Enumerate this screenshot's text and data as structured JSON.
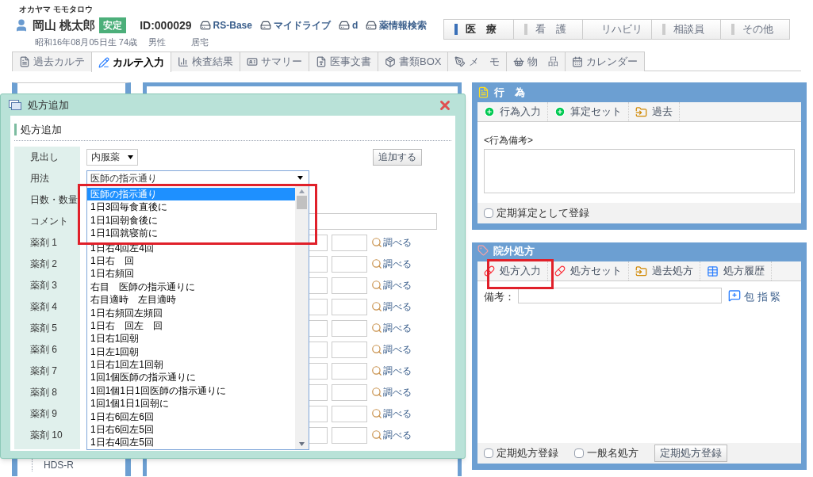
{
  "patient": {
    "kana": "オカヤマ モモタロウ",
    "name": "岡山 桃太郎",
    "status": "安定",
    "id": "ID:000029",
    "links": [
      "RS-Base",
      "マイドライブ",
      "d",
      "薬情報検索"
    ],
    "birth": "昭和16年08月05日生 74歳",
    "sex": "男性",
    "residence": "居宅"
  },
  "dept_tabs": [
    {
      "label": "医　療",
      "selected": true
    },
    {
      "label": "看　護",
      "selected": false
    },
    {
      "label": "リハビリ",
      "selected": false
    },
    {
      "label": "相談員",
      "selected": false
    },
    {
      "label": "その他",
      "selected": false
    }
  ],
  "main_tabs": [
    {
      "label": "過去カルテ",
      "selected": false
    },
    {
      "label": "カルテ入力",
      "selected": true
    },
    {
      "label": "検査結果",
      "selected": false
    },
    {
      "label": "サマリー",
      "selected": false
    },
    {
      "label": "医事文書",
      "selected": false
    },
    {
      "label": "書類BOX",
      "selected": false
    },
    {
      "label": "メ　モ",
      "selected": false
    },
    {
      "label": "物　品",
      "selected": false
    },
    {
      "label": "カレンダー",
      "selected": false
    }
  ],
  "sidebar": {
    "items": [
      "HDS-R"
    ]
  },
  "act_panel": {
    "title": "行　為",
    "toolbar": [
      "行為入力",
      "算定セット",
      "過去"
    ],
    "note_label": "<行為備考>",
    "footer_checkbox": {
      "label": "定期算定として登録",
      "checked": false
    }
  },
  "rx_panel": {
    "title": "院外処方",
    "toolbar": [
      "処方入力",
      "処方セット",
      "過去処方",
      "処方履歴"
    ],
    "note_label": "備考：",
    "note_tags": "包 指 緊",
    "footer_checkboxes": [
      {
        "label": "定期処方登録",
        "checked": false
      },
      {
        "label": "一般名処方",
        "checked": false
      }
    ],
    "footer_button": "定期処方登録"
  },
  "modal": {
    "title": "処方追加",
    "section_title": "処方追加",
    "heading": {
      "label": "見出し",
      "value": "内服薬"
    },
    "add_button": "追加する",
    "usage": {
      "label": "用法",
      "value": "医師の指示通り"
    },
    "days_label": "日数・数量",
    "comment_label": "コメント",
    "drugs": [
      {
        "label": "薬剤 1",
        "link": "調べる"
      },
      {
        "label": "薬剤 2",
        "link": "調べる"
      },
      {
        "label": "薬剤 3",
        "link": "調べる"
      },
      {
        "label": "薬剤 4",
        "link": "調べる"
      },
      {
        "label": "薬剤 5",
        "link": "調べる"
      },
      {
        "label": "薬剤 6",
        "link": "調べる"
      },
      {
        "label": "薬剤 7",
        "link": "調べる"
      },
      {
        "label": "薬剤 8",
        "link": "調べる"
      },
      {
        "label": "薬剤 9",
        "link": "調べる"
      },
      {
        "label": "薬剤 10",
        "link": "調べる"
      }
    ],
    "usage_options": [
      {
        "label": "医師の指示通り",
        "selected": true
      },
      {
        "label": "1日3回毎食直後に",
        "selected": false
      },
      {
        "label": "1日1回朝食後に",
        "selected": false
      },
      {
        "label": "1日1回就寝前に",
        "selected": false
      },
      {
        "label": "1日右4回左4回",
        "selected": false
      },
      {
        "label": "1日右　回",
        "selected": false
      },
      {
        "label": "1日右頻回",
        "selected": false
      },
      {
        "label": "右目　医師の指示通りに",
        "selected": false
      },
      {
        "label": "右目適時　左目適時",
        "selected": false
      },
      {
        "label": "1日右頻回左頻回",
        "selected": false
      },
      {
        "label": "1日右　回左　回",
        "selected": false
      },
      {
        "label": "1日右1回朝",
        "selected": false
      },
      {
        "label": "1日左1回朝",
        "selected": false
      },
      {
        "label": "1日右1回左1回朝",
        "selected": false
      },
      {
        "label": "1回1個医師の指示通りに",
        "selected": false
      },
      {
        "label": "1回1個1日1回医師の指示通りに",
        "selected": false
      },
      {
        "label": "1回1個1日1回朝に",
        "selected": false
      },
      {
        "label": "1日右6回左6回",
        "selected": false
      },
      {
        "label": "1日右6回左5回",
        "selected": false
      },
      {
        "label": "1日右4回左5回",
        "selected": false
      }
    ]
  }
}
